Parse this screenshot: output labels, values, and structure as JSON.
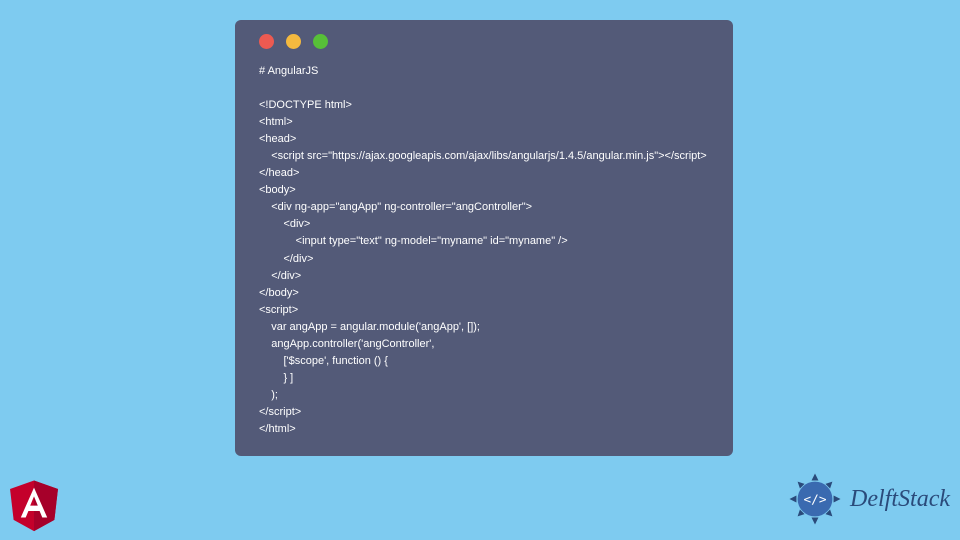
{
  "code": {
    "title": "# AngularJS",
    "lines": [
      "<!DOCTYPE html>",
      "<html>",
      "<head>",
      "    <script src=\"https://ajax.googleapis.com/ajax/libs/angularjs/1.4.5/angular.min.js\"></script>",
      "</head>",
      "<body>",
      "    <div ng-app=\"angApp\" ng-controller=\"angController\">",
      "        <div>",
      "            <input type=\"text\" ng-model=\"myname\" id=\"myname\" />",
      "        </div>",
      "    </div>",
      "</body>",
      "<script>",
      "    var angApp = angular.module('angApp', []);",
      "    angApp.controller('angController',",
      "        ['$scope', function () {",
      "        } ]",
      "    );",
      "</script>",
      "</html>"
    ]
  },
  "brand": {
    "name": "DelftStack"
  },
  "colors": {
    "page_bg": "#7ecbf0",
    "window_bg": "#535a78",
    "angular_red": "#c4002b",
    "delft_blue": "#2a4a7a"
  }
}
